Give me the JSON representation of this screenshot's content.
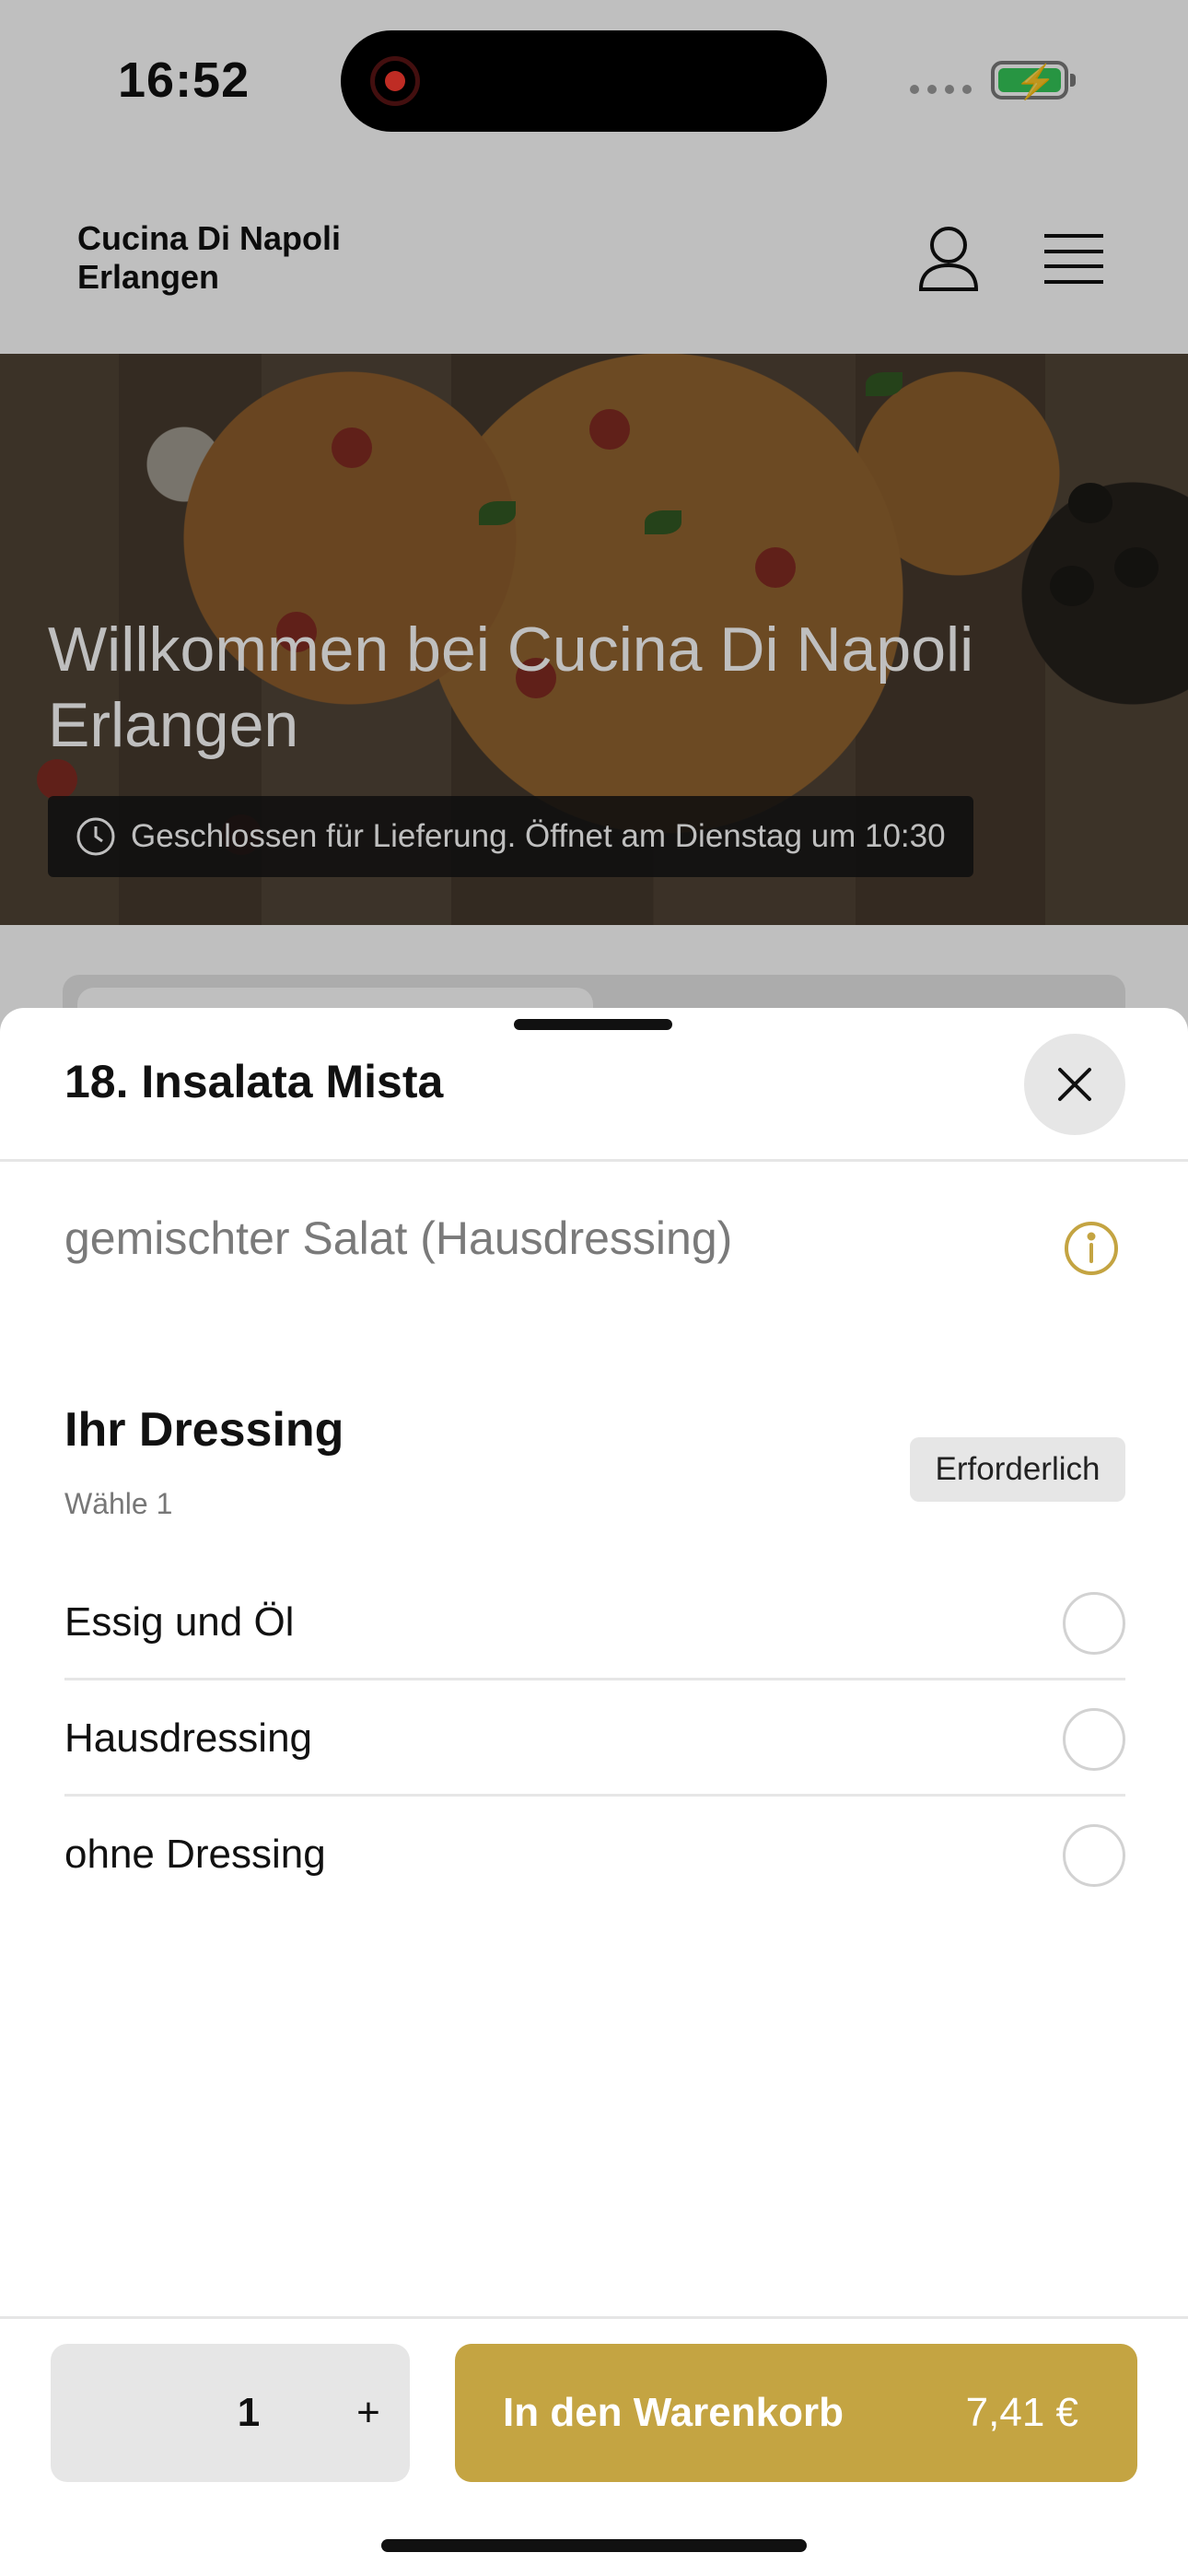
{
  "status_bar": {
    "time": "16:52"
  },
  "site": {
    "brand": "Cucina Di Napoli Erlangen"
  },
  "hero": {
    "title": "Willkommen bei Cucina Di Napoli Erlangen",
    "status": "Geschlossen für Lieferung. Öffnet am Dienstag um 10:30"
  },
  "sheet": {
    "title": "18. Insalata Mista",
    "description": "gemischter Salat (Hausdressing)",
    "group": {
      "title": "Ihr Dressing",
      "subtitle": "Wähle 1",
      "badge": "Erforderlich",
      "options": [
        {
          "label": "Essig und Öl"
        },
        {
          "label": "Hausdressing"
        },
        {
          "label": "ohne Dressing"
        }
      ]
    },
    "footer": {
      "quantity": "1",
      "plus": "+",
      "add_label": "In den Warenkorb",
      "price": "7,41 €"
    }
  },
  "colors": {
    "accent": "#c4a442",
    "battery": "#34c759",
    "record": "#ff3b30"
  },
  "icons": [
    "user-icon",
    "menu-icon",
    "clock-icon",
    "close-icon",
    "info-icon"
  ]
}
